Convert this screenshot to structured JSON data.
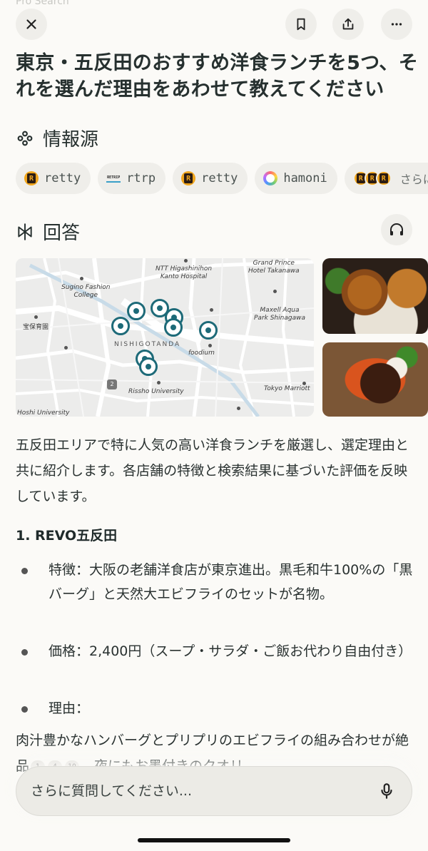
{
  "header": {
    "ghost_label": "Pro Search",
    "close_icon": "close-icon",
    "bookmark_icon": "bookmark-icon",
    "share_icon": "share-icon",
    "more_icon": "more-icon"
  },
  "question": "東京・五反田のおすすめ洋食ランチを5つ、それを選んだ理由をあわせて教えてください",
  "sources": {
    "title": "情報源",
    "items": [
      {
        "label": "retty",
        "icon": "retty-logo-icon"
      },
      {
        "label": "rtrp",
        "icon": "rtrp-logo-icon"
      },
      {
        "label": "retty",
        "icon": "retty-logo-icon"
      },
      {
        "label": "hamoni",
        "icon": "hamoni-logo-icon"
      }
    ],
    "more_label": "さらに"
  },
  "answer": {
    "title": "回答",
    "map_labels": {
      "ntt": "NTT Higashinihon\nKanto Hospital",
      "grand_prince": "Grand Prince\nHotel Takanawa",
      "sugino": "Sugino Fashion\nCollege",
      "maxell": "Maxell Aqua\nPark Shinagawa",
      "hodoen": "宝保育園",
      "nishigotanda": "NISHIGOTANDA",
      "foodium": "foodium",
      "rissho": "Rissho University",
      "tokyo_marriott": "Tokyo Marriott",
      "hoshi": "Hoshi University",
      "route": "2"
    },
    "intro": "五反田エリアで特に人気の高い洋食ランチを厳選し、選定理由と共に紹介します。各店舗の特徴と検索結果に基づいた評価を反映しています。",
    "item1": {
      "title": "1. REVO五反田",
      "feature": "特徴：大阪の老舗洋食店が東京進出。黒毛和牛100%の「黒バーグ」と天然大エビフライのセットが名物。",
      "price": "価格：2,400円（スープ・サラダ・ご飯お代わり自由付き）",
      "reason": "理由：",
      "reason_text": "肉汁豊かなハンバーグとプリプリのエビフライの組み合わせが絶品",
      "citations": [
        "1",
        "4",
        "10"
      ],
      "reason_tail": "。夜にもお墨付きのクオリ"
    }
  },
  "ask": {
    "placeholder": "さらに質問してください..."
  }
}
